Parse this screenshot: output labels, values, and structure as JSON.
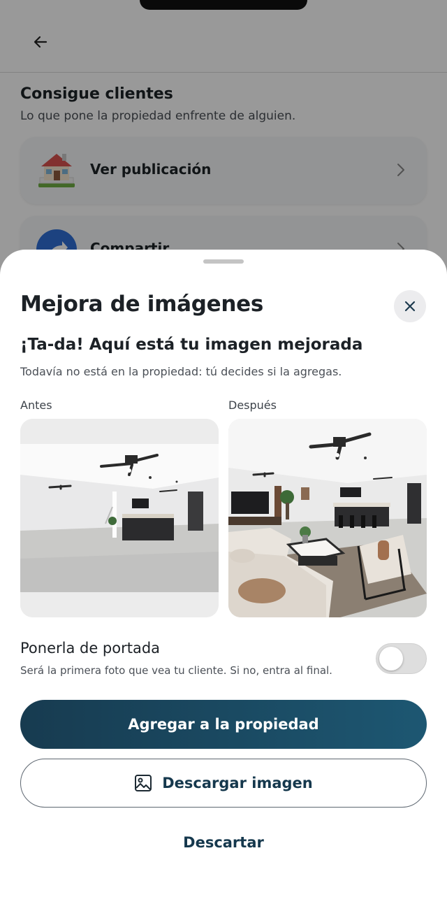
{
  "background": {
    "section_title": "Consigue clientes",
    "section_subtitle": "Lo que pone la propiedad enfrente de alguien.",
    "cards": [
      {
        "label": "Ver publicación",
        "icon": "house-icon"
      },
      {
        "label": "Compartir",
        "icon": "share-icon"
      }
    ]
  },
  "sheet": {
    "title": "Mejora de imágenes",
    "headline": "¡Ta-da! Aquí está tu imagen mejorada",
    "subtext": "Todavía no está en la propiedad: tú decides si la agregas.",
    "before_label": "Antes",
    "after_label": "Después",
    "cover": {
      "title": "Ponerla de portada",
      "subtitle": "Será la primera foto que vea tu cliente. Si no, entra al final.",
      "enabled": false
    },
    "primary_button": "Agregar a la propiedad",
    "download_button": "Descargar imagen",
    "discard_button": "Descartar"
  },
  "colors": {
    "primary": "#173b50",
    "primary_end": "#1d5772",
    "text_dark": "#1c2126",
    "link": "#15384d"
  }
}
